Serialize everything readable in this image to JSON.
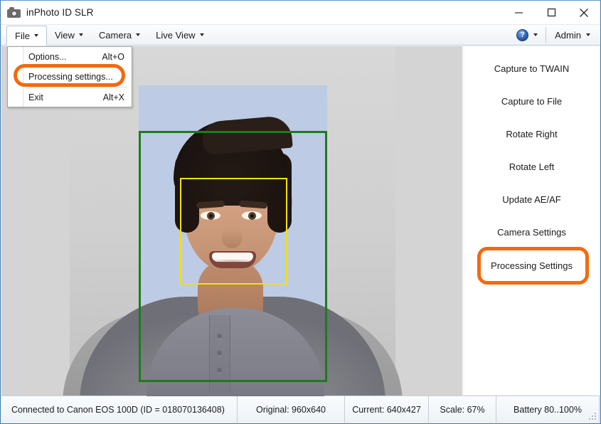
{
  "window": {
    "title": "inPhoto ID SLR",
    "icon": "camera-icon",
    "minimize_label": "Minimize",
    "maximize_label": "Maximize",
    "close_label": "Close"
  },
  "menubar": {
    "items": [
      {
        "label": "File",
        "active": true
      },
      {
        "label": "View",
        "active": false
      },
      {
        "label": "Camera",
        "active": false
      },
      {
        "label": "Live View",
        "active": false
      }
    ],
    "help": {
      "icon": "help-icon",
      "label": "?"
    },
    "user": {
      "label": "Admin"
    }
  },
  "file_menu": {
    "items": [
      {
        "label": "Options...",
        "accel": "Alt+O",
        "highlighted": false
      },
      {
        "label": "Processing settings...",
        "accel": "",
        "highlighted": true
      },
      {
        "label": "Exit",
        "accel": "Alt+X",
        "highlighted": false
      }
    ]
  },
  "preview": {
    "crop_rect_color": "#1f7a1f",
    "face_rect_color": "#f2e205",
    "background_color": "#d4d4d4",
    "photo_background_color": "#bdcbe4"
  },
  "sidepanel": {
    "buttons": [
      {
        "label": "Capture to TWAIN",
        "highlighted": false
      },
      {
        "label": "Capture to File",
        "highlighted": false
      },
      {
        "label": "Rotate Right",
        "highlighted": false
      },
      {
        "label": "Rotate Left",
        "highlighted": false
      },
      {
        "label": "Update AE/AF",
        "highlighted": false
      },
      {
        "label": "Camera Settings",
        "highlighted": false
      },
      {
        "label": "Processing Settings",
        "highlighted": true
      }
    ]
  },
  "statusbar": {
    "connection": "Connected to Canon EOS 100D (ID = 018070136408)",
    "original": "Original: 960x640",
    "current": "Current: 640x427",
    "scale": "Scale: 67%",
    "battery": "Battery 80..100%"
  },
  "annotation": {
    "color": "#f26a0f"
  }
}
